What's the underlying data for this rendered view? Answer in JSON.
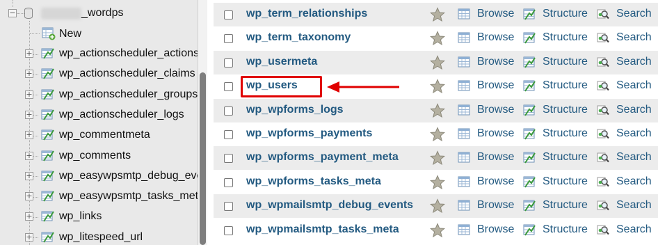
{
  "nav": {
    "database": {
      "name_suffix": "_wordps",
      "expander": "−"
    },
    "new_label": "New",
    "items": [
      {
        "label": "wp_actionscheduler_actions",
        "expander": "+"
      },
      {
        "label": "wp_actionscheduler_claims",
        "expander": "+"
      },
      {
        "label": "wp_actionscheduler_groups",
        "expander": "+"
      },
      {
        "label": "wp_actionscheduler_logs",
        "expander": "+"
      },
      {
        "label": "wp_commentmeta",
        "expander": "+"
      },
      {
        "label": "wp_comments",
        "expander": "+"
      },
      {
        "label": "wp_easywpsmtp_debug_events",
        "expander": "+"
      },
      {
        "label": "wp_easywpsmtp_tasks_meta",
        "expander": "+"
      },
      {
        "label": "wp_links",
        "expander": "+"
      },
      {
        "label": "wp_litespeed_url",
        "expander": "+"
      }
    ]
  },
  "table_list": {
    "actions": {
      "browse": "Browse",
      "structure": "Structure",
      "search": "Search"
    },
    "rows": [
      {
        "name": "wp_term_relationships"
      },
      {
        "name": "wp_term_taxonomy"
      },
      {
        "name": "wp_usermeta"
      },
      {
        "name": "wp_users",
        "highlighted": true
      },
      {
        "name": "wp_wpforms_logs"
      },
      {
        "name": "wp_wpforms_payments"
      },
      {
        "name": "wp_wpforms_payment_meta"
      },
      {
        "name": "wp_wpforms_tasks_meta"
      },
      {
        "name": "wp_wpmailsmtp_debug_events"
      },
      {
        "name": "wp_wpmailsmtp_tasks_meta"
      }
    ]
  },
  "colors": {
    "link": "#235a81",
    "highlight": "#e00000",
    "nav_bg": "#e9e9e9",
    "row_alt": "#ececec"
  },
  "icons": {
    "star": "star-icon",
    "browse": "browse-table-icon",
    "structure": "structure-icon",
    "search": "search-magnifier-icon",
    "table": "table-icon",
    "new": "new-table-icon"
  }
}
